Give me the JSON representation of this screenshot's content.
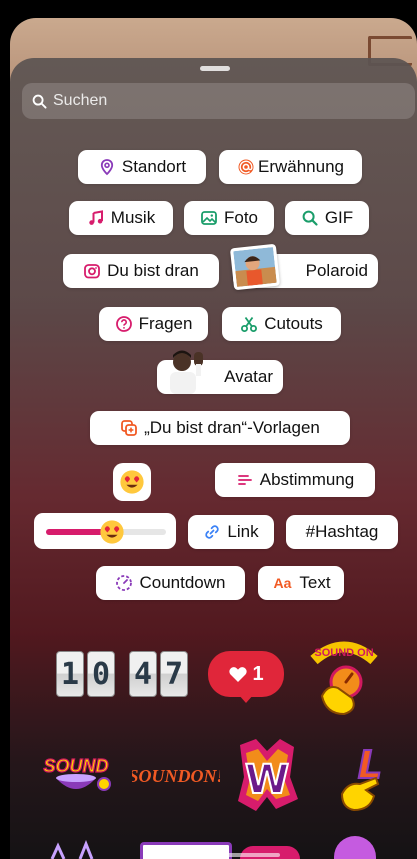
{
  "search": {
    "placeholder": "Suchen"
  },
  "stickers": {
    "standort": "Standort",
    "erwaehnung": "Erwähnung",
    "musik": "Musik",
    "foto": "Foto",
    "gif": "GIF",
    "du_bist_dran": "Du bist dran",
    "polaroid": "Polaroid",
    "fragen": "Fragen",
    "cutouts": "Cutouts",
    "avatar": "Avatar",
    "vorlagen": "„Du bist dran“-Vorlagen",
    "abstimmung": "Abstimmung",
    "link": "Link",
    "hashtag": "#Hashtag",
    "countdown": "Countdown",
    "text": "Text"
  },
  "emoji_slider": {
    "value": 0.55
  },
  "clock_sticker": {
    "hours": [
      "1",
      "0"
    ],
    "minutes": [
      "4",
      "7"
    ]
  },
  "like_sticker": {
    "count": "1"
  },
  "art_stickers": {
    "sound_on": "SOUND ON",
    "sound": "SOUND",
    "sound_on_2": "SOUNDON!",
    "letter_w": "W",
    "letter_l": "L"
  },
  "colors": {
    "accent_pink": "#d71c6c",
    "accent_orange": "#f15a24",
    "accent_purple": "#8a3ab9",
    "link_blue": "#3b82f6",
    "like_red": "#e0263a"
  }
}
